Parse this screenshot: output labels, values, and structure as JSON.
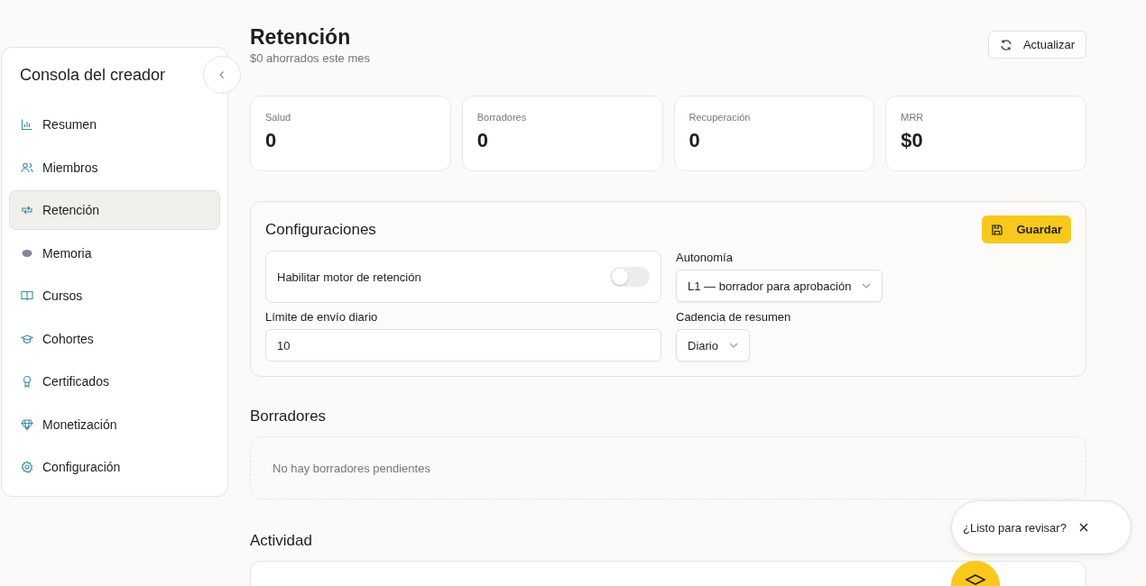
{
  "sidebar": {
    "title": "Consola del creador",
    "items": [
      {
        "label": "Resumen",
        "selected": false
      },
      {
        "label": "Miembros",
        "selected": false
      },
      {
        "label": "Retención",
        "selected": true
      },
      {
        "label": "Memoria",
        "selected": false
      },
      {
        "label": "Cursos",
        "selected": false
      },
      {
        "label": "Cohortes",
        "selected": false
      },
      {
        "label": "Certificados",
        "selected": false
      },
      {
        "label": "Monetización",
        "selected": false
      },
      {
        "label": "Configuración",
        "selected": false
      }
    ]
  },
  "header": {
    "title": "Retención",
    "subtitle": "$0 ahorrados este mes",
    "refresh_button": "Actualizar"
  },
  "stats": [
    {
      "label": "Salud",
      "value": "0"
    },
    {
      "label": "Borradores",
      "value": "0"
    },
    {
      "label": "Recuperación",
      "value": "0"
    },
    {
      "label": "MRR",
      "value": "$0"
    }
  ],
  "settings": {
    "title": "Configuraciones",
    "save_button": "Guardar",
    "engine_toggle": {
      "label": "Habilitar motor de retención",
      "on": false
    },
    "autonomy": {
      "label": "Autonomía",
      "value": "L1 — borrador para aprobación"
    },
    "daily_limit": {
      "label": "Límite de envío diario",
      "value": "10"
    },
    "digest": {
      "label": "Cadencia de resumen",
      "value": "Diario"
    }
  },
  "drafts": {
    "title": "Borradores",
    "empty_text": "No hay borradores pendientes"
  },
  "activity": {
    "title": "Actividad"
  },
  "review_popup": {
    "text": "¿Listo para revisar?"
  }
}
